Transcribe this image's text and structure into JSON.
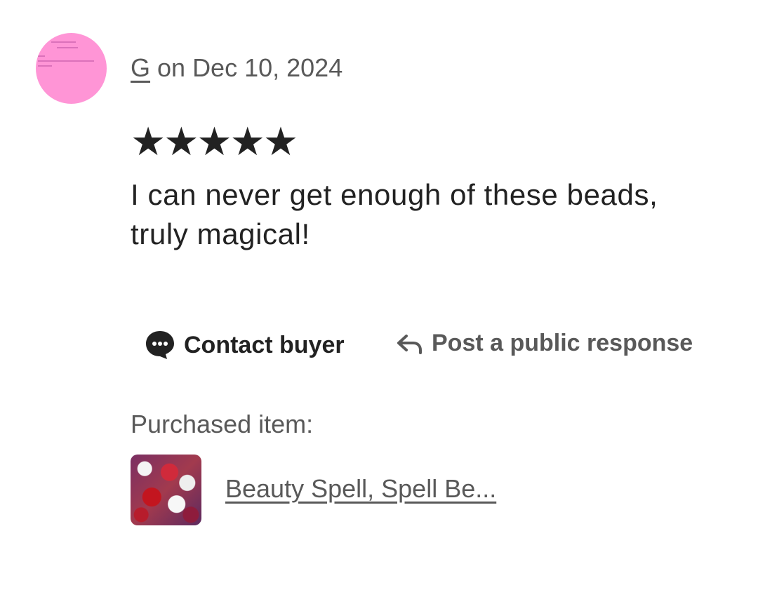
{
  "review": {
    "author": "G",
    "date_text": " on Dec 10, 2024",
    "rating": 5,
    "stars_text": "★★★★★",
    "text": "I can never get enough of these beads, truly magical!"
  },
  "actions": {
    "contact_label": "Contact buyer",
    "respond_label": "Post a public response"
  },
  "purchased": {
    "label": "Purchased item:",
    "item_title": "Beauty Spell, Spell Be..."
  },
  "colors": {
    "avatar_bg": "#ff95d6",
    "text_primary": "#222222",
    "text_secondary": "#595959"
  },
  "icons": [
    "chat-bubble-icon",
    "reply-arrow-icon"
  ]
}
